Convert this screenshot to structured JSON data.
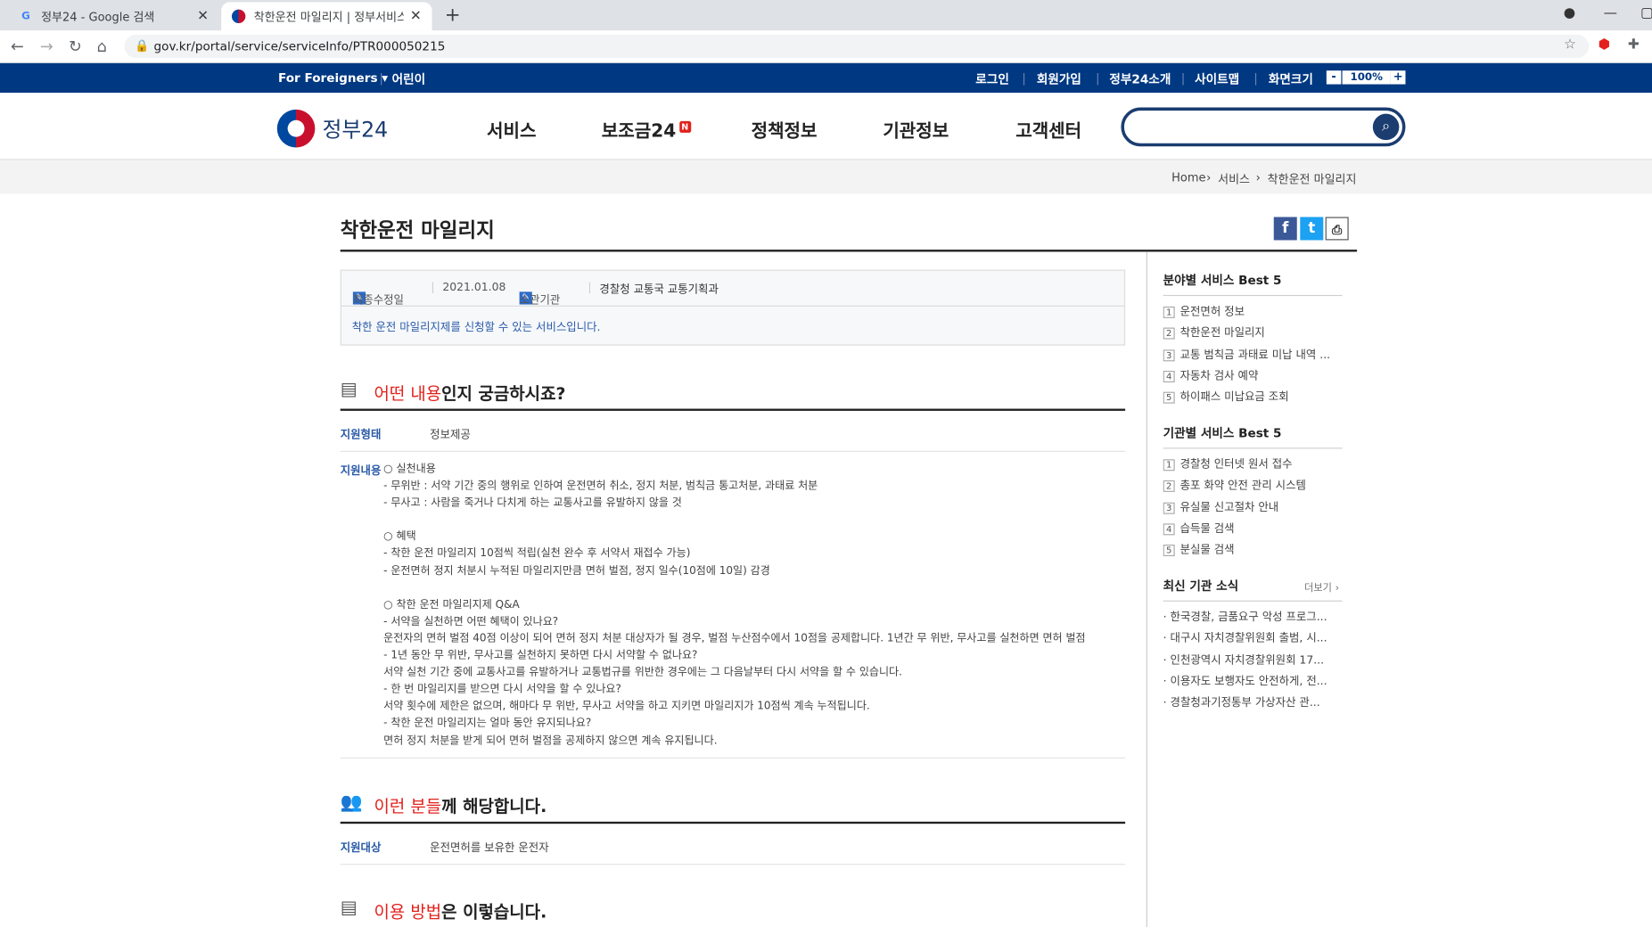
{
  "browser": {
    "tabs": [
      {
        "title": "정부24 - Google 검색",
        "favicon": "G",
        "close": "✕"
      },
      {
        "title": "착한운전 마일리지 | 정부서비스",
        "favicon": "",
        "close": "✕"
      }
    ],
    "new_tab": "+",
    "url": "gov.kr/portal/service/serviceInfo/PTR000050215"
  },
  "topbar": {
    "foreigners": "For Foreigners ▾",
    "kids": "어린이",
    "login": "로그인",
    "signup": "회원가입",
    "about": "정부24소개",
    "sitemap": "사이트맵",
    "screensize": "화면크기",
    "zoom_minus": "-",
    "zoom": "100%",
    "zoom_plus": "+"
  },
  "header": {
    "logo": "정부24",
    "nav": [
      "서비스",
      "보조금24",
      "정책정보",
      "기관정보",
      "고객센터"
    ],
    "new_badge": "N",
    "search_placeholder": ""
  },
  "breadcrumb": [
    "Home",
    "서비스",
    "착한운전 마일리지"
  ],
  "page": {
    "title": "착한운전 마일리지",
    "info": {
      "updated_label": "최종수정일",
      "updated": "2021.01.08",
      "dept_label": "소관기관",
      "dept": "경찰청 교통국 교통기획과",
      "desc": "착한 운전 마일리지제를 신청할 수 있는 서비스입니다."
    },
    "section1": {
      "title_red": "어떤 내용",
      "title_rest": "인지 궁금하시죠?",
      "type_label": "지원형태",
      "type_value": "정보제공",
      "content_label": "지원내용",
      "content_lines": [
        "○ 실천내용",
        "- 무위반 : 서약 기간 중의 행위로 인하여 운전면허 취소, 정지 처분, 범칙금 통고처분, 과태료 처분",
        "- 무사고 : 사람을 죽거나 다치게 하는 교통사고를 유발하지 않을 것",
        "",
        "○ 혜택",
        "- 착한 운전 마일리지 10점씩 적립(실천 완수 후 서약서 재접수 가능)",
        "- 운전면허 정지 처분시 누적된 마일리지만큼 면허 벌점, 정지 일수(10점에 10일) 감경",
        "",
        "○ 착한 운전 마일리지제 Q&A",
        "- 서약을 실천하면 어떤 혜택이 있나요?",
        " 운전자의 면허 벌점 40점 이상이 되어 면허 정지 처분 대상자가 될 경우, 벌점 누산점수에서 10점을 공제합니다. 1년간 무 위반, 무사고를 실천하면 면허 벌점",
        "- 1년 동안 무 위반, 무사고를 실천하지 못하면 다시 서약할 수 없나요?",
        " 서약 실천 기간 중에 교통사고를 유발하거나 교통법규를 위반한 경우에는 그 다음날부터 다시 서약을 할 수 있습니다.",
        "- 한 번 마일리지를 받으면 다시 서약을 할 수 있나요?",
        " 서약 횟수에 제한은 없으며, 해마다 무 위반, 무사고 서약을 하고 지키면 마일리지가 10점씩 계속 누적됩니다.",
        "- 착한 운전 마일리지는 얼마 동안 유지되나요?",
        " 면허 정지 처분을 받게 되어 면허 벌점을 공제하지 않으면 계속 유지됩니다."
      ]
    },
    "section2": {
      "title_red": "이런 분들",
      "title_rest": "께 해당합니다.",
      "target_label": "지원대상",
      "target_value": "운전면허를 보유한 운전자"
    },
    "section3": {
      "title_red": "이용 방법",
      "title_rest": "은 이렇습니다."
    }
  },
  "sidebar": {
    "best_field_title": "분야별 서비스 Best 5",
    "best_field": [
      "운전면허 정보",
      "착한운전 마일리지",
      "교통 범칙금 과태료 미납 내역 ...",
      "자동차 검사 예약",
      "하이패스 미납요금 조회"
    ],
    "best_agency_title": "기관별 서비스 Best 5",
    "best_agency": [
      "경찰청 인터넷 원서 접수",
      "총포 화약 안전 관리 시스템",
      "유실물 신고절차 안내",
      "습득물 검색",
      "분실물 검색"
    ],
    "news_title": "최신 기관 소식",
    "news_more": "더보기 ›",
    "news": [
      "· 한국경찰, 금품요구 악성 프로그...",
      "· 대구시 자치경찰위원회 출범, 시...",
      "· 인천광역시 자치경찰위원회 17...",
      "· 이용자도 보행자도 안전하게, 전...",
      "· 경찰청과기정통부 가상자산 관..."
    ]
  },
  "colors": {
    "brand_blue": "#003882",
    "accent_red": "#e2211c",
    "link_blue": "#2a5aa8"
  }
}
